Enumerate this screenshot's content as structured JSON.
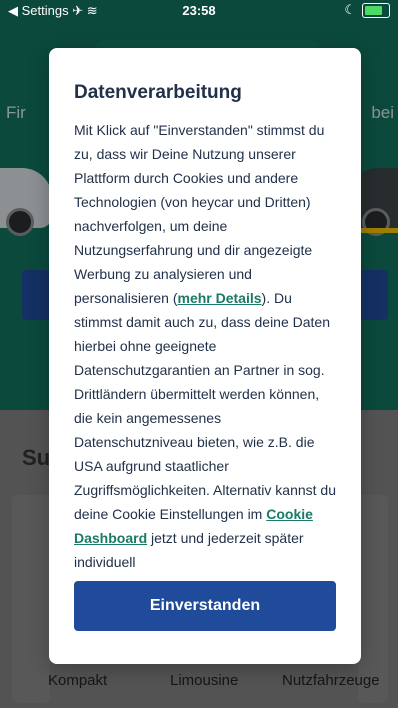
{
  "statusbar": {
    "back_label": "◀ Settings",
    "time": "23:58"
  },
  "background": {
    "headline_left": "Fir",
    "headline_right": "bei",
    "section_title": "Su",
    "categories": [
      "Kompakt",
      "Limousine",
      "Nutzfahrzeuge"
    ]
  },
  "dialog": {
    "title": "Datenverarbeitung",
    "body_part1": "Mit Klick auf \"Einverstanden\" stimmst du zu, dass wir Deine Nutzung unserer Plattform durch Cookies und andere Technologien (von heycar und Dritten) nachverfolgen, um deine Nutzungserfahrung und dir angezeigte Werbung zu analysieren und personalisieren (",
    "details_link": "mehr Details",
    "body_part2": "). Du stimmst damit auch zu, dass deine Daten hierbei ohne geeignete Datenschutzgarantien an Partner in sog. Drittländern übermittelt werden können, die kein angemessenes Datenschutzniveau bieten, wie z.B. die USA aufgrund staatlicher Zugriffsmöglichkeiten. Alternativ kannst du deine Cookie Einstellungen im ",
    "dashboard_link": "Cookie Dashboard",
    "body_part3": " jetzt und jederzeit später individuell",
    "accept_label": "Einverstanden"
  },
  "colors": {
    "brand_green": "#12705f",
    "primary_button": "#204a9a",
    "link": "#1a7a66"
  }
}
